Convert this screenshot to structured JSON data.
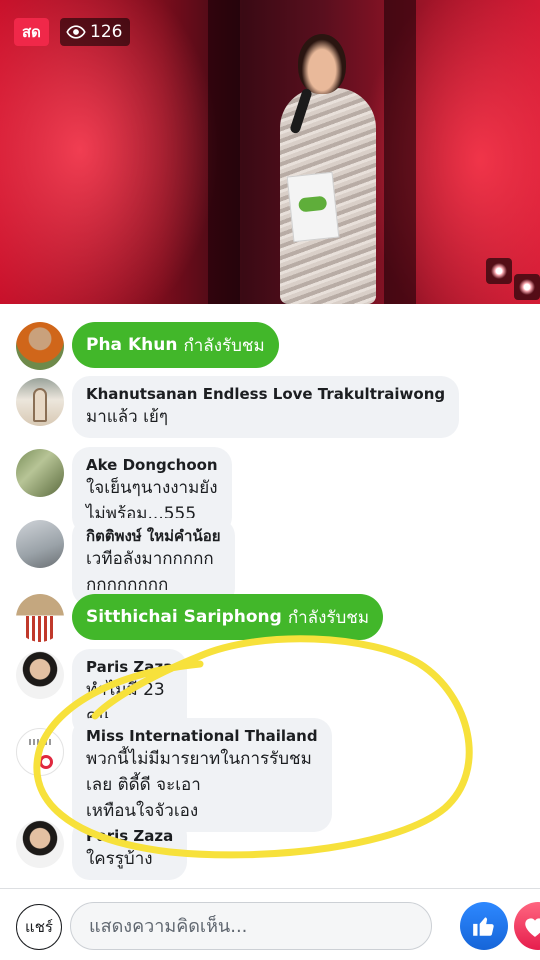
{
  "live": {
    "badge": "สด",
    "viewer_count": "126",
    "icons": {
      "viewers": "eye-icon"
    }
  },
  "comments": [
    {
      "type": "joined",
      "name": "Pha Khun",
      "status": "กำลังรับชม"
    },
    {
      "type": "comment",
      "name": "Khanutsanan Endless Love Trakultraiwong",
      "text": "มาแล้ว เย้ๆ"
    },
    {
      "type": "comment",
      "name": "Ake Dongchoon",
      "text": "ใจเย็นๆนางงามยังไม่พร้อม...555"
    },
    {
      "type": "comment",
      "name": "กิตติพงษ์ ใหม่คำน้อย",
      "text": "เวทีอลังมากกกกกกกกกกกกก"
    },
    {
      "type": "joined",
      "name": "Sitthichai Sariphong",
      "status": "กำลังรับชม"
    },
    {
      "type": "comment",
      "name": "Paris Zaza",
      "text": "ทำไมมี 23 คน"
    },
    {
      "type": "comment",
      "name": "Miss International Thailand",
      "text_line1": "พวกนี้ไม่มีมารยาทในการรับชมเลย ติดี้ดี จะเอา",
      "text_line2": "เหทือนใจจัวเอง"
    },
    {
      "type": "comment",
      "name": "Paris Zaza",
      "text": "ใครรูบ้าง"
    }
  ],
  "composer": {
    "share_label": "แชร์",
    "placeholder": "แสดงความคิดเห็น...",
    "icons": {
      "like": "thumbs-up-icon",
      "love": "heart-icon"
    }
  },
  "colors": {
    "live_red": "#f02849",
    "joined_green": "#42b72a",
    "bubble_gray": "#f0f2f5",
    "like_blue": "#1877f2",
    "highlight_yellow": "#f7e13b"
  }
}
